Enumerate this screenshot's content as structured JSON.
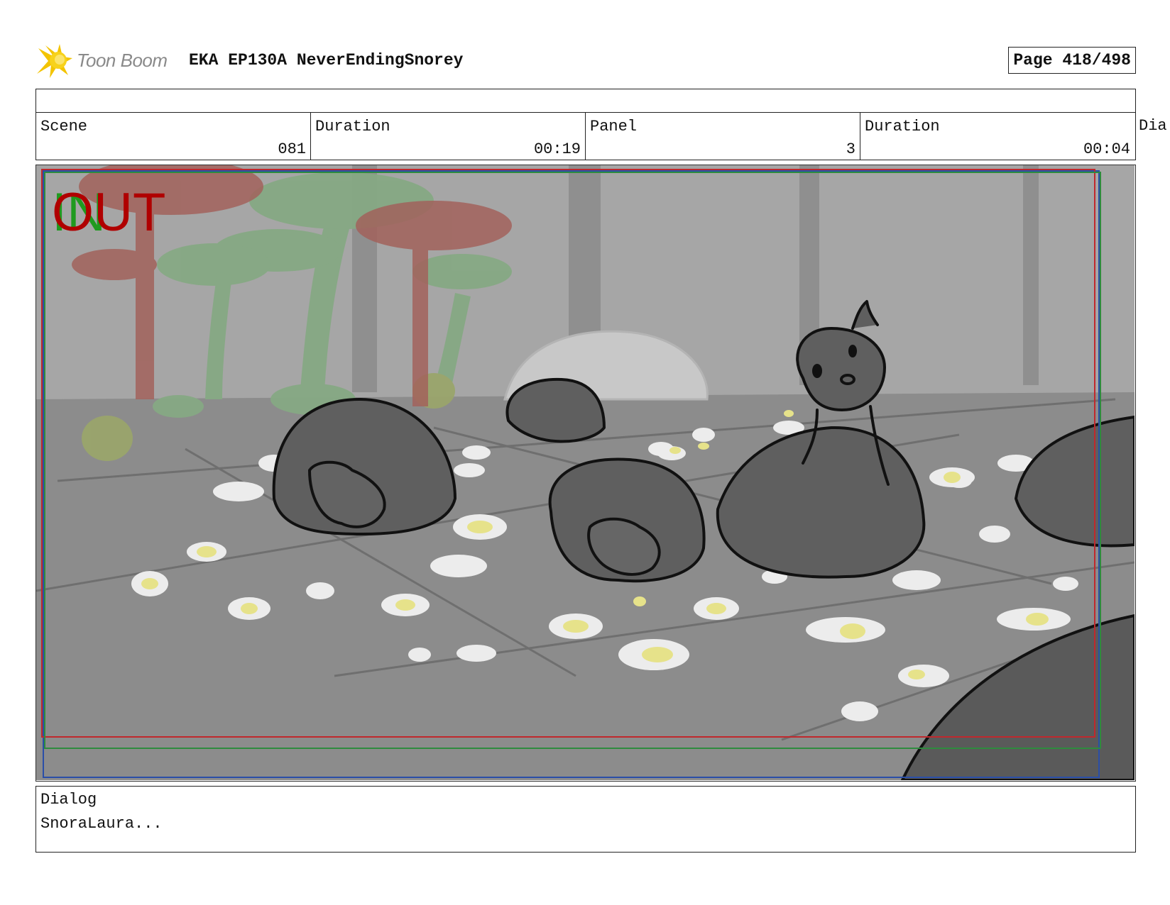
{
  "header": {
    "logo_text": "Toon Boom",
    "title": "EKA EP130A NeverEndingSnorey",
    "page": "Page 418/498"
  },
  "info": {
    "scene_label": "Scene",
    "scene_value": "081",
    "scene_duration_label": "Duration",
    "scene_duration_value": "00:19",
    "panel_label": "Panel",
    "panel_value": "3",
    "panel_duration_label": "Duration",
    "panel_duration_value": "00:04",
    "overflow_label": "Dia"
  },
  "panel_image": {
    "overlay_out": "OUT",
    "overlay_in": "IN",
    "colors": {
      "out_red": "#b00000",
      "in_green": "#1f9a1f",
      "safe_frame_red": "#c0282d",
      "safe_frame_green": "#2e8b3e",
      "safe_frame_blue": "#2a4ea8",
      "ground": "#8d8d8d",
      "creature": "#5e5e5e"
    }
  },
  "dialog": {
    "label": "Dialog",
    "text": "SnoraLaura..."
  }
}
